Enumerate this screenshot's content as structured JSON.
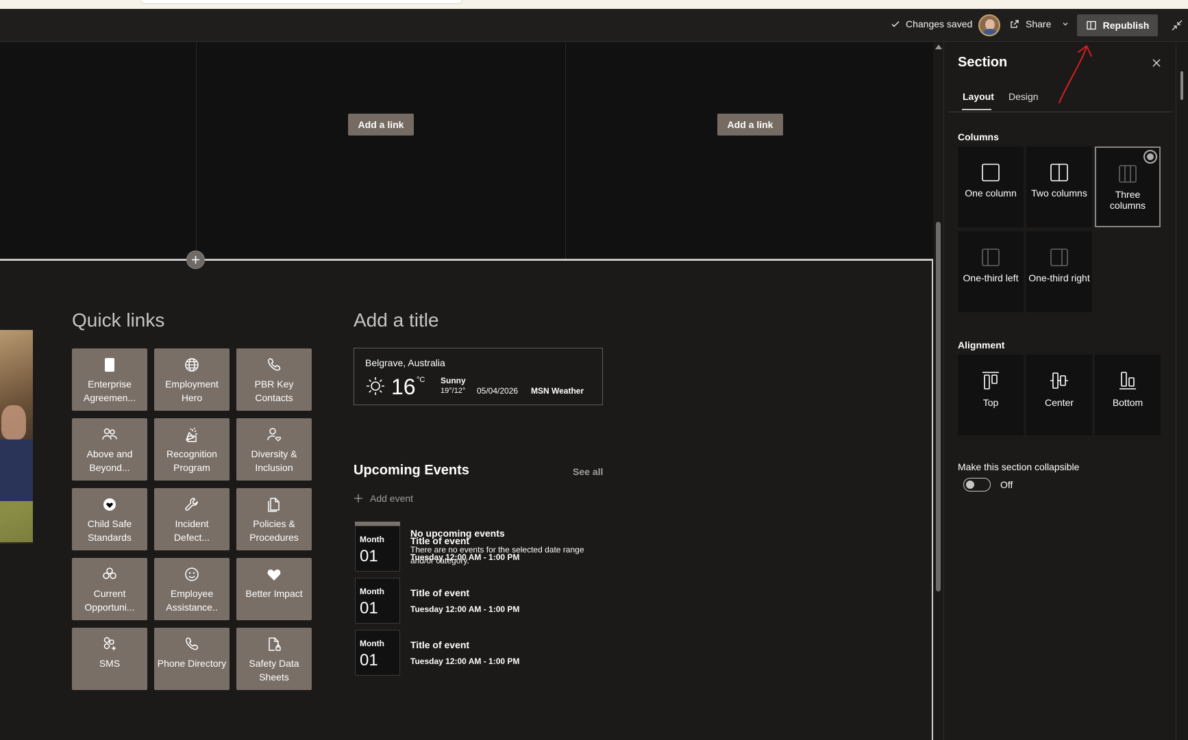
{
  "cmdbar": {
    "saved": "Changes saved",
    "share": "Share",
    "republish": "Republish"
  },
  "canvas": {
    "add_link_1": "Add a link",
    "add_link_2": "Add a link"
  },
  "quick_links": {
    "title": "Quick links",
    "tiles": [
      {
        "label": "Enterprise Agreemen...",
        "icon": "document-icon"
      },
      {
        "label": "Employment Hero",
        "icon": "globe-icon"
      },
      {
        "label": "PBR Key Contacts",
        "icon": "phone-icon"
      },
      {
        "label": "Above and Beyond...",
        "icon": "people-icon"
      },
      {
        "label": "Recognition Program",
        "icon": "celebration-icon"
      },
      {
        "label": "Diversity & Inclusion",
        "icon": "person-heart-icon"
      },
      {
        "label": "Child Safe Standards",
        "icon": "badge-heart-icon"
      },
      {
        "label": "Incident Defect...",
        "icon": "wrench-icon"
      },
      {
        "label": "Policies & Procedures",
        "icon": "document-pages-icon"
      },
      {
        "label": "Current Opportuni...",
        "icon": "teams-icon"
      },
      {
        "label": "Employee Assistance..",
        "icon": "smiley-icon"
      },
      {
        "label": "Better Impact",
        "icon": "heart-icon"
      },
      {
        "label": "SMS",
        "icon": "people-add-icon"
      },
      {
        "label": "Phone Directory",
        "icon": "phone-icon"
      },
      {
        "label": "Safety Data Sheets",
        "icon": "document-lock-icon"
      }
    ]
  },
  "weather": {
    "section_title": "Add a title",
    "location": "Belgrave, Australia",
    "temp": "16",
    "unit": "°C",
    "condition": "Sunny",
    "range": "19°/12°",
    "date": "05/04/2026",
    "source": "MSN Weather"
  },
  "events": {
    "title": "Upcoming Events",
    "see_all": "See all",
    "add_event": "Add event",
    "none_title": "No upcoming events",
    "none_desc": "There are no events for the selected date range and/or category.",
    "items": [
      {
        "month": "Month",
        "day": "01",
        "name": "Title of event",
        "time": "Tuesday 12:00 AM - 1:00 PM"
      },
      {
        "month": "Month",
        "day": "01",
        "name": "Title of event",
        "time": "Tuesday 12:00 AM - 1:00 PM"
      },
      {
        "month": "Month",
        "day": "01",
        "name": "Title of event",
        "time": "Tuesday 12:00 AM - 1:00 PM"
      }
    ]
  },
  "panel": {
    "title": "Section",
    "tabs": {
      "layout": "Layout",
      "design": "Design"
    },
    "columns_label": "Columns",
    "columns": {
      "one": "One column",
      "two": "Two columns",
      "three": "Three columns",
      "third_left": "One-third left",
      "third_right": "One-third right"
    },
    "selected_column": "Three columns",
    "alignment_label": "Alignment",
    "alignment": {
      "top": "Top",
      "center": "Center",
      "bottom": "Bottom"
    },
    "collapsible_label": "Make this section collapsible",
    "collapsible_state": "Off"
  },
  "colors": {
    "tile_bg": "#7a6f67",
    "annotation": "#d61f1f"
  }
}
